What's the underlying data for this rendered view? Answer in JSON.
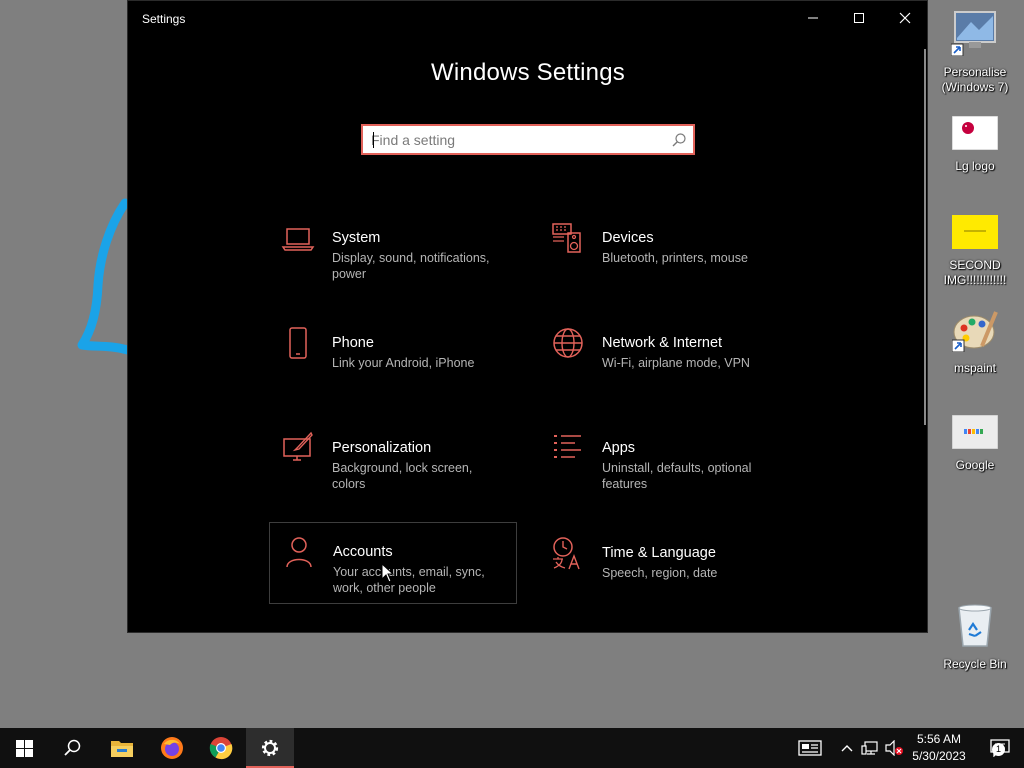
{
  "window": {
    "title": "Settings",
    "minimize": "minimize",
    "maximize": "maximize",
    "close": "close"
  },
  "settings": {
    "heading": "Windows Settings",
    "search_placeholder": "Find a setting",
    "accent_color": "#e2625a",
    "tiles": [
      {
        "name": "System",
        "desc": "Display, sound, notifications, power",
        "icon": "laptop-icon"
      },
      {
        "name": "Devices",
        "desc": "Bluetooth, printers, mouse",
        "icon": "keyboard-speaker-icon"
      },
      {
        "name": "Phone",
        "desc": "Link your Android, iPhone",
        "icon": "phone-icon"
      },
      {
        "name": "Network & Internet",
        "desc": "Wi-Fi, airplane mode, VPN",
        "icon": "globe-icon"
      },
      {
        "name": "Personalization",
        "desc": "Background, lock screen, colors",
        "icon": "paint-monitor-icon"
      },
      {
        "name": "Apps",
        "desc": "Uninstall, defaults, optional features",
        "icon": "apps-list-icon"
      },
      {
        "name": "Accounts",
        "desc": "Your accounts, email, sync, work, other people",
        "icon": "person-icon"
      },
      {
        "name": "Time & Language",
        "desc": "Speech, region, date",
        "icon": "time-language-icon"
      }
    ]
  },
  "desktop": {
    "icons": [
      {
        "label": "Personalise (Windows 7)",
        "icon": "monitor-shortcut-icon"
      },
      {
        "label": "Lg logo",
        "icon": "lg-logo-image"
      },
      {
        "label": "SECOND IMG!!!!!!!!!!!!",
        "icon": "yellow-image"
      },
      {
        "label": "mspaint",
        "icon": "palette-icon"
      },
      {
        "label": "Google",
        "icon": "google-image"
      },
      {
        "label": "Recycle Bin",
        "icon": "recycle-bin-icon"
      }
    ]
  },
  "taskbar": {
    "apps": [
      "start-icon",
      "search-icon",
      "file-explorer-icon",
      "firefox-icon",
      "chrome-icon",
      "settings-icon"
    ],
    "time": "5:56 AM",
    "date": "5/30/2023",
    "notification_count": "1"
  }
}
